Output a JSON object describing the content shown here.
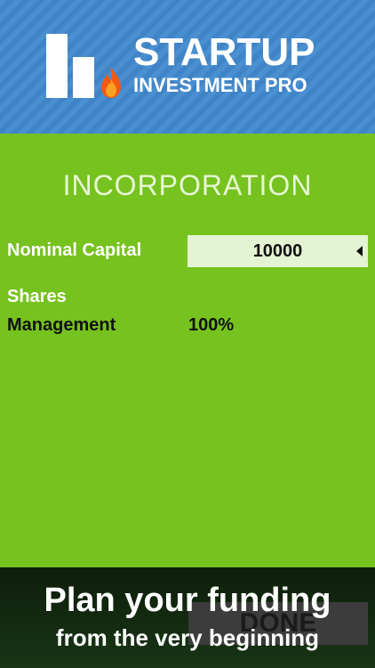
{
  "header": {
    "brand_title": "STARTUP",
    "brand_subtitle": "INVESTMENT PRO",
    "logo_icon": "bar-chart-flame-icon",
    "bg_color": "#4a8fd0"
  },
  "main": {
    "section_title": "INCORPORATION",
    "nominal_capital_label": "Nominal Capital",
    "nominal_capital_value": "10000",
    "shares_label": "Shares",
    "management_label": "Management",
    "management_value": "100%",
    "bg_color": "#76c21f"
  },
  "footer": {
    "done_label": "DONE",
    "promo_line1": "Plan your funding",
    "promo_line2": "from the very beginning"
  }
}
